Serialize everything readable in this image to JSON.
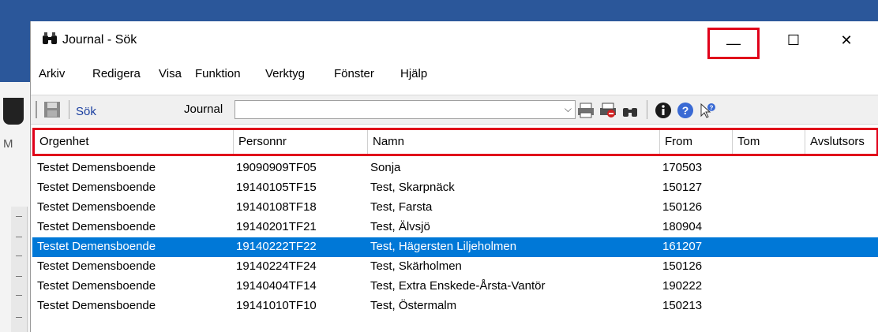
{
  "window": {
    "title": "Journal - Sök",
    "buttons": {
      "minimize": "—",
      "maximize": "☐",
      "close": "✕"
    }
  },
  "menu": [
    "Arkiv",
    "Redigera",
    "Visa",
    "Funktion",
    "Verktyg",
    "Fönster",
    "Hjälp"
  ],
  "toolbar": {
    "sok_label": "Sök",
    "combo_value": "Journal",
    "icons": [
      "save-icon",
      "print-icon",
      "print-preview-icon",
      "find-icon",
      "info-icon",
      "help-icon",
      "whats-this-icon"
    ]
  },
  "background": {
    "letter": "M"
  },
  "table": {
    "columns": [
      "Orgenhet",
      "Personnr",
      "Namn",
      "From",
      "Tom",
      "Avslutsors"
    ],
    "rows": [
      {
        "orgenhet": "Testet Demensboende",
        "personnr": "19090909TF05",
        "namn": "Sonja",
        "from": "170503",
        "tom": ""
      },
      {
        "orgenhet": "Testet Demensboende",
        "personnr": "19140105TF15",
        "namn": "Test, Skarpnäck",
        "from": "150127",
        "tom": ""
      },
      {
        "orgenhet": "Testet Demensboende",
        "personnr": "19140108TF18",
        "namn": "Test, Farsta",
        "from": "150126",
        "tom": ""
      },
      {
        "orgenhet": "Testet Demensboende",
        "personnr": "19140201TF21",
        "namn": "Test, Älvsjö",
        "from": "180904",
        "tom": ""
      },
      {
        "orgenhet": "Testet Demensboende",
        "personnr": "19140222TF22",
        "namn": "Test, Hägersten Liljeholmen",
        "from": "161207",
        "tom": "",
        "selected": true
      },
      {
        "orgenhet": "Testet Demensboende",
        "personnr": "19140224TF24",
        "namn": "Test, Skärholmen",
        "from": "150126",
        "tom": ""
      },
      {
        "orgenhet": "Testet Demensboende",
        "personnr": "19140404TF14",
        "namn": "Test, Extra Enskede-Årsta-Vantör",
        "from": "190222",
        "tom": ""
      },
      {
        "orgenhet": "Testet Demensboende",
        "personnr": "19141010TF10",
        "namn": "Test, Östermalm",
        "from": "150213",
        "tom": ""
      }
    ]
  }
}
